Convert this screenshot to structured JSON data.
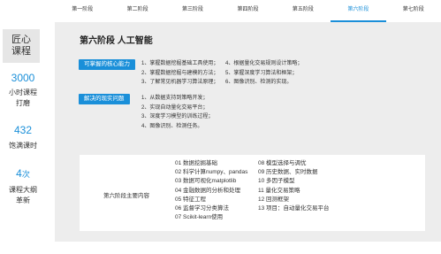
{
  "sidebar": {
    "brand_line1": "匠心",
    "brand_line2": "课程",
    "stats": [
      {
        "value": "3000",
        "suffix": "",
        "label_line1": "小时课程",
        "label_line2": "打磨"
      },
      {
        "value": "432",
        "suffix": "",
        "label_line1": "饱满课时",
        "label_line2": ""
      },
      {
        "value": "4",
        "suffix": "次",
        "label_line1": "课程大纲",
        "label_line2": "革新"
      }
    ]
  },
  "tabs": [
    {
      "label": "第一阶段"
    },
    {
      "label": "第二阶段"
    },
    {
      "label": "第三阶段"
    },
    {
      "label": "第四阶段"
    },
    {
      "label": "第五阶段"
    },
    {
      "label": "第六阶段"
    },
    {
      "label": "第七阶段"
    }
  ],
  "main": {
    "title": "第六阶段 人工智能",
    "core_ability_label": "可掌握的核心能力",
    "core_abilities_left": [
      "1、掌握数据挖掘基础工具使用；",
      "2、掌握数据挖掘与建模的方法；",
      "3、了解常见机器学习算法原理；"
    ],
    "core_abilities_right": [
      "4、根据量化交易规则设计策略；",
      "5、掌握深度学习算法和框架；",
      "6、图像识别、检测的实现。"
    ],
    "problem_label": "解决的现实问题",
    "problems": [
      "1、从数据支持到策略开发；",
      "2、实现自动量化交易平台；",
      "3、深度学习模型的训练过程；",
      "4、图像识别、检测任务。"
    ],
    "content_label": "第六阶段主要内容",
    "content_left": [
      "01 数据挖掘基础",
      "02 科学计算numpy、pandas",
      "03 数据可视化matplotlib",
      "04 金融数据的分析和处理",
      "05 特征工程",
      "06 监督学习分类算法",
      "07 Scikit-learn使用"
    ],
    "content_right": [
      "08 模型选择与调优",
      "09 历史数据、实时数据",
      "10 多因子模型",
      "11 量化交易策略",
      "12 回测框架",
      "13 项目：自动量化交易平台"
    ]
  }
}
